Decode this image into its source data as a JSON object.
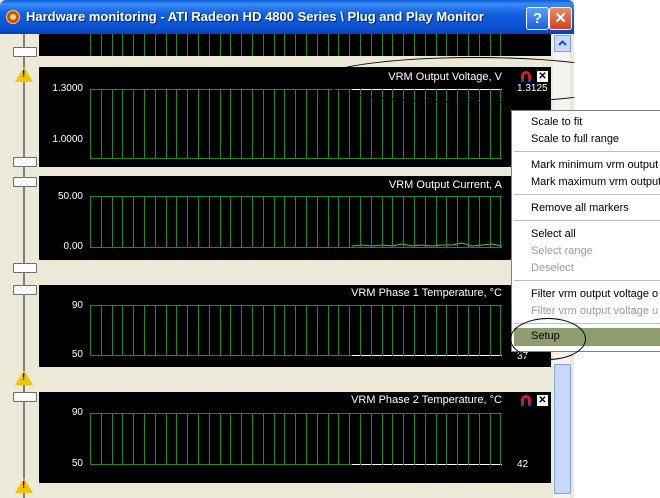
{
  "window": {
    "title": "Hardware monitoring - ATI Radeon HD 4800 Series \\ Plug and Play Monitor",
    "help_label": "?",
    "close_label": "✕"
  },
  "panels": [
    {
      "title": "VRM Output Voltage, V",
      "y_top": "1.3000",
      "y_bottom": "1.0000",
      "current": "1.3125",
      "has_icons": true
    },
    {
      "title": "VRM Output Current, A",
      "y_top": "50.00",
      "y_bottom": "0.00",
      "current": "",
      "has_icons": false
    },
    {
      "title": "VRM Phase 1 Temperature, °C",
      "y_top": "90",
      "y_bottom": "50",
      "current": "37",
      "has_icons": false
    },
    {
      "title": "VRM Phase 2 Temperature, °C",
      "y_top": "90",
      "y_bottom": "50",
      "current": "42",
      "has_icons": true
    }
  ],
  "icons": {
    "magnet": "magnet-icon",
    "close": "close-x-icon",
    "warning": "warning-icon"
  },
  "colors": {
    "grid": "#1f8c1f",
    "trace_highlight": "#ffffff",
    "menu_highlight": "#8e9d6e"
  },
  "context_menu": {
    "items": [
      {
        "label": "Scale to fit",
        "disabled": false
      },
      {
        "label": "Scale to full range",
        "disabled": false
      },
      {
        "label": "Mark minimum vrm output v",
        "disabled": false
      },
      {
        "label": "Mark maximum vrm output",
        "disabled": false
      },
      {
        "label": "Remove all markers",
        "disabled": false
      },
      {
        "label": "Select all",
        "disabled": false
      },
      {
        "label": "Select range",
        "disabled": true
      },
      {
        "label": "Deselect",
        "disabled": true
      },
      {
        "label": "Filter vrm output voltage o",
        "disabled": false
      },
      {
        "label": "Filter vrm output voltage u",
        "disabled": true
      },
      {
        "label": "Setup",
        "disabled": false,
        "highlighted": true
      }
    ]
  }
}
